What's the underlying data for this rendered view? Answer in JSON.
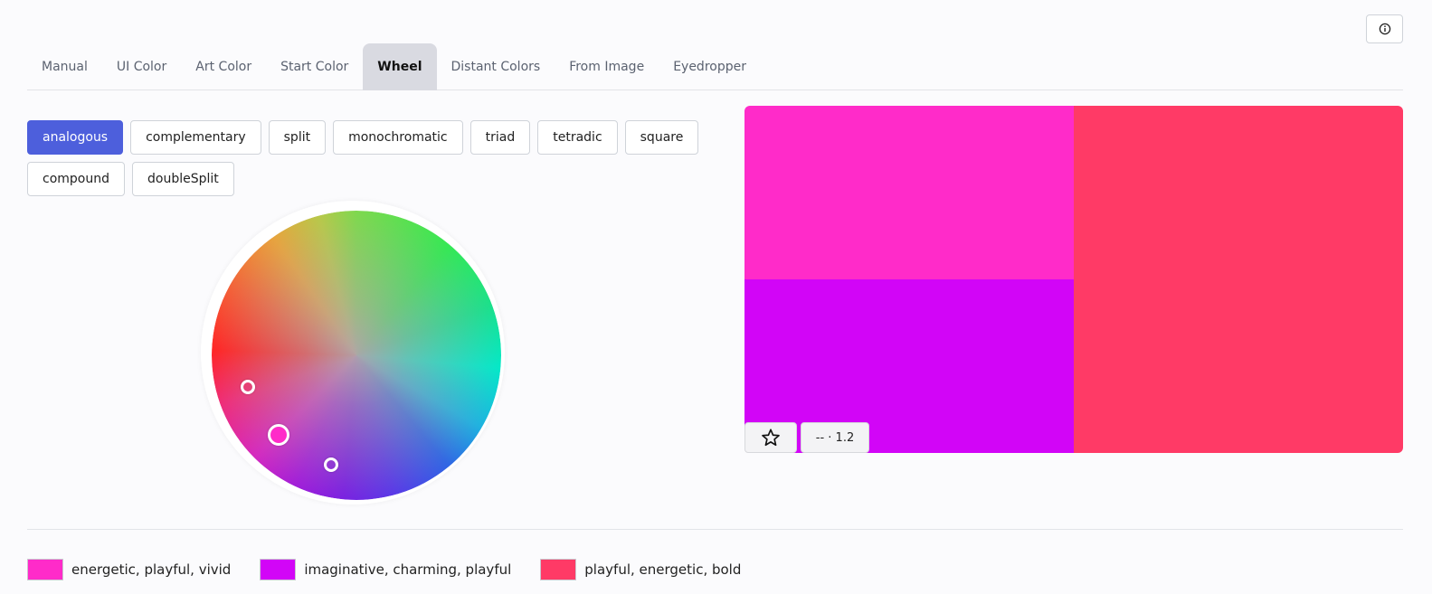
{
  "tabs": [
    {
      "label": "Manual"
    },
    {
      "label": "UI Color"
    },
    {
      "label": "Art Color"
    },
    {
      "label": "Start Color"
    },
    {
      "label": "Wheel",
      "active": true
    },
    {
      "label": "Distant Colors"
    },
    {
      "label": "From Image"
    },
    {
      "label": "Eyedropper"
    }
  ],
  "harmonies": [
    {
      "label": "analogous",
      "active": true
    },
    {
      "label": "complementary"
    },
    {
      "label": "split"
    },
    {
      "label": "monochromatic"
    },
    {
      "label": "triad"
    },
    {
      "label": "tetradic"
    },
    {
      "label": "square"
    },
    {
      "label": "compound"
    },
    {
      "label": "doubleSplit"
    }
  ],
  "palette": {
    "colors": [
      "#ff2bc9",
      "#d205f7",
      "#ff3a66"
    ],
    "contrast_label": "-- · 1.2"
  },
  "legend": [
    {
      "color": "#ff2bc9",
      "label": "energetic, playful, vivid"
    },
    {
      "color": "#d205f7",
      "label": "imaginative, charming, playful"
    },
    {
      "color": "#ff3a66",
      "label": "playful, energetic, bold"
    }
  ],
  "icons": {
    "info": "info-icon",
    "favorite": "star-icon"
  },
  "colors": {
    "accent": "#4d5fdc",
    "active_tab_bg": "#d9dae1"
  }
}
